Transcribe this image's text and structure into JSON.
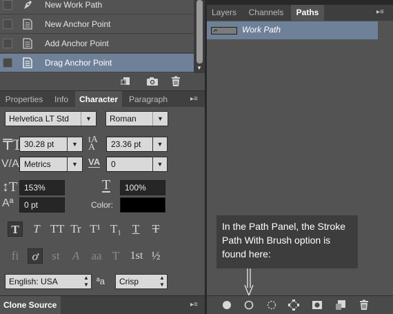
{
  "history": {
    "items": [
      {
        "label": "New Work Path",
        "icon": "pen-icon",
        "selected": false
      },
      {
        "label": "New Anchor Point",
        "icon": "document-icon",
        "selected": false
      },
      {
        "label": "Add Anchor Point",
        "icon": "document-icon",
        "selected": false
      },
      {
        "label": "Drag Anchor Point",
        "icon": "document-icon",
        "selected": true
      }
    ],
    "tools": [
      "new-document-from-state-icon",
      "camera-snapshot-icon",
      "trash-icon"
    ]
  },
  "character_panel": {
    "tabs": [
      "Properties",
      "Info",
      "Character",
      "Paragraph"
    ],
    "active_tab": "Character",
    "font_family": "Helvetica LT Std",
    "font_style": "Roman",
    "font_size": "30.28 pt",
    "leading": "23.36 pt",
    "kerning": "Metrics",
    "tracking": "0",
    "vertical_scale": "153%",
    "horizontal_scale": "100%",
    "baseline_shift": "0 pt",
    "color_label": "Color:",
    "color_value": "#000000",
    "style_buttons": [
      "T",
      "T",
      "TT",
      "Tr",
      "T¹",
      "T₁",
      "T",
      "T"
    ],
    "opentype_buttons": [
      "fi",
      "ơ",
      "st",
      "A",
      "aa",
      "T",
      "1st",
      "½"
    ],
    "language": "English: USA",
    "aa_label": "ªa",
    "antialias": "Crisp"
  },
  "clone_source": {
    "label": "Clone Source"
  },
  "paths_panel": {
    "tabs": [
      "Layers",
      "Channels",
      "Paths"
    ],
    "active_tab": "Paths",
    "items": [
      {
        "label": "Work Path",
        "selected": true
      }
    ],
    "callout": "In the Path Panel, the Stroke Path With Brush option is found here:",
    "tools": [
      "fill-path-icon",
      "stroke-path-icon",
      "load-path-as-selection-icon",
      "make-work-path-icon",
      "add-mask-icon",
      "new-path-icon",
      "delete-path-icon"
    ]
  },
  "colors": {
    "selection": "#6f8199",
    "panel": "#535353",
    "callout": "#3d3d3d"
  }
}
